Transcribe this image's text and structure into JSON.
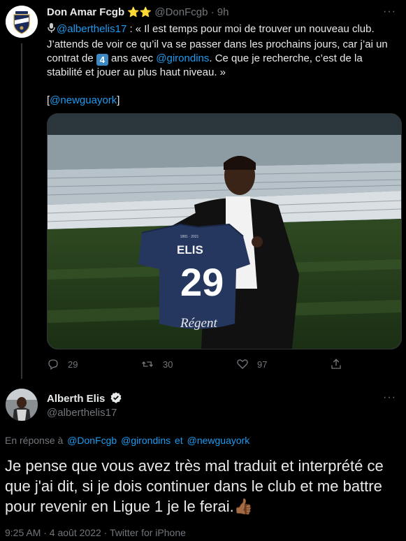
{
  "tweet1": {
    "display_name": "Don Amar Fcgb",
    "stars": "⭐⭐",
    "handle": "@DonFcgb",
    "time": "9h",
    "mention": "@alberthelis17",
    "text_a": " : « Il est temps pour moi de trouver un nouveau club. J’attends de voir ce qu’il va se passer dans les prochains jours, car j’ai un contrat de ",
    "number_badge": "4",
    "text_b": " ans avec ",
    "mention2": "@girondins",
    "text_c": ". Ce que je recherche, c’est de la stabilité et jouer au plus haut niveau. »",
    "credit_open": "[",
    "credit_handle": "@newguayork",
    "credit_close": "]",
    "media": {
      "jersey_name": "ELIS",
      "jersey_number": "29",
      "jersey_years": "1881 · 2021",
      "sponsor": "Régent"
    },
    "actions": {
      "replies": "29",
      "retweets": "30",
      "likes": "97"
    }
  },
  "tweet2": {
    "display_name": "Alberth Elis",
    "handle": "@alberthelis17",
    "reply_prefix": "En réponse à",
    "reply_handles": [
      "@DonFcgb",
      "@girondins",
      "et",
      "@newguayork"
    ],
    "text": "Je pense que vous avez très mal traduit et interprété ce que j'ai dit, si je dois continuer dans le club et me battre pour revenir en Ligue 1 je le ferai.",
    "emoji": "👍🏾",
    "meta": "9:25 AM · 4 août 2022 · Twitter for iPhone"
  },
  "colors": {
    "background": "#000000",
    "text": "#e7e9ea",
    "muted": "#71767b",
    "link": "#1d9bf0",
    "verified": "#e7e9ea"
  },
  "icons": [
    "bordeaux-crest-icon",
    "microphone-icon",
    "reply-icon",
    "retweet-icon",
    "like-icon",
    "share-icon",
    "verified-icon",
    "more-icon"
  ]
}
